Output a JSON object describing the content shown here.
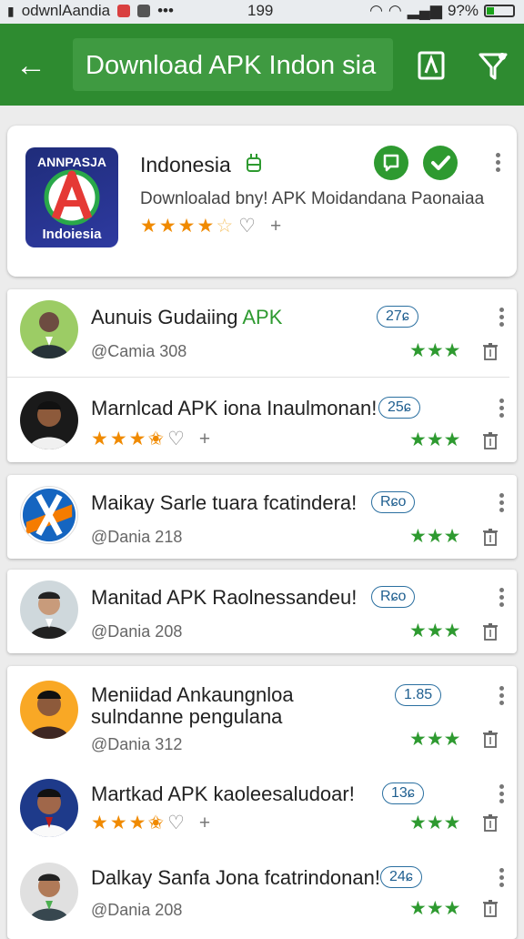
{
  "status": {
    "carrier": "odwnlAandia",
    "time": "199",
    "battery": "9?%"
  },
  "appbar": {
    "search_value": "Download APK Indon sia"
  },
  "featured": {
    "logo_top": "ANNPASJA",
    "logo_bottom": "Indoiesia",
    "title": "Indonesia",
    "subtitle": "Downloalad bny! APK  Moidandana Paonaiaa",
    "rating": 3.5
  },
  "apps": [
    {
      "title": "Aunuis Gudaiing",
      "title_highlight": "APK",
      "subtitle": "@Camia 308",
      "badge": "27ɕ",
      "rating_style": "green"
    },
    {
      "title": "Marnlcad APK iona Inaulmonan!",
      "subtitle": "",
      "badge": "25ɕ",
      "rating_style": "orange",
      "rating": 3.5
    },
    {
      "title": "Maikay Sarle tuara fcatindera!",
      "subtitle": "@Dania 218",
      "badge": "Rɕo",
      "rating_style": "green"
    },
    {
      "title": "Manitad APK Raolnessandeu!",
      "subtitle": "@Dania 208",
      "badge": "Rɕo",
      "rating_style": "green"
    },
    {
      "title": "Meniidad Ankaungnloa sulndanne pengulana",
      "subtitle": "@Dania 312",
      "badge": "1.85",
      "rating_style": "green"
    },
    {
      "title": "Martkad APK kaoleesaludoar!",
      "subtitle": "",
      "badge": "13ɕ",
      "rating_style": "orange",
      "rating": 3.5
    },
    {
      "title": "Dalkay Sanfa Jona fcatrindonan!",
      "subtitle": "@Dania 208",
      "badge": "24ɕ",
      "rating_style": "green"
    }
  ],
  "icons": [
    "back-arrow-icon",
    "bookmark-icon",
    "filter-icon",
    "robot-icon",
    "chat-icon",
    "check-icon",
    "kebab-icon",
    "trash-icon",
    "heart-icon",
    "plus-icon"
  ],
  "colors": {
    "appbar": "#2e8b30",
    "accent_green": "#2e9a30",
    "star_orange": "#f08a00",
    "badge_blue": "#1f5f90"
  }
}
